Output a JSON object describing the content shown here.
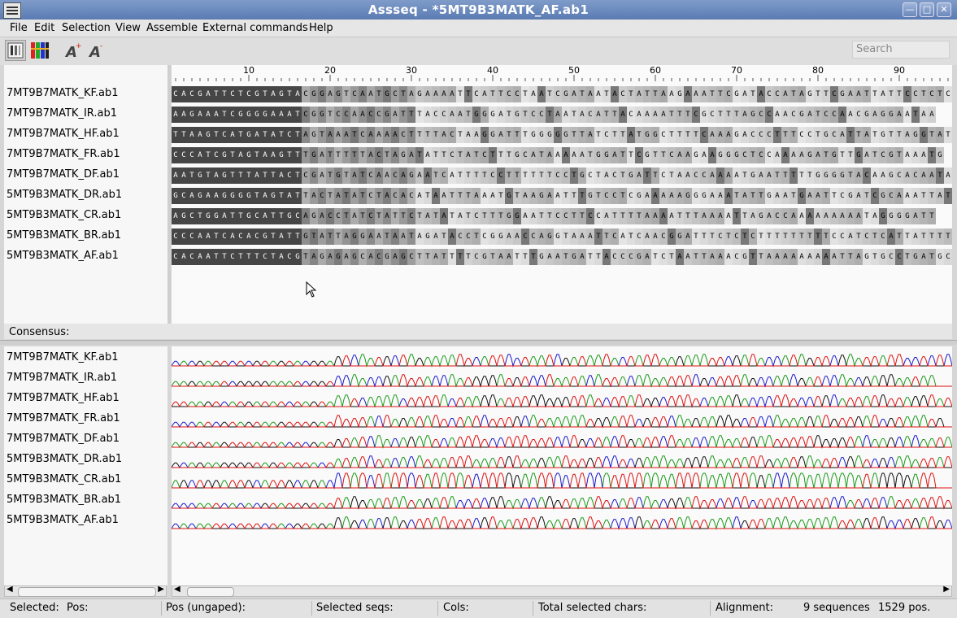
{
  "window": {
    "title": "Assseq - *5MT9B3MATK_AF.ab1"
  },
  "menu": [
    "File",
    "Edit",
    "Selection",
    "View",
    "Assemble",
    "External commands",
    "Help"
  ],
  "toolbar": {
    "buttons": [
      "view-bars-icon",
      "view-color-icon",
      "font-increase-icon",
      "font-decrease-icon"
    ],
    "search_placeholder": "Search"
  },
  "ruler_ticks": [
    "10",
    "20",
    "30",
    "40",
    "50",
    "60",
    "70",
    "80",
    "90"
  ],
  "sequences": [
    {
      "name": "7MT9B7MATK_KF.ab1",
      "bases": "CACGATTCTCGTAGTACGGAGTCAATGCTAGAAAATTCATTCCTAATCGATAATACTATTAAGAAATTCGATACCATAGTTCGAATTATTCCTCTC"
    },
    {
      "name": "7MT9B7MATK_IR.ab1",
      "bases": "AAGAAATCGGGGAAATCGGTCCAACCGATTTACCAATGGGATGTCCTAATACATTACAAAATTTCGCTTTAGCCAACGATCCAACGAGGAATAA"
    },
    {
      "name": "7MT9B7MATK_HF.ab1",
      "bases": "TTAAGTCATGATATCTAGTAAATCAAAACTTTTACTAAGGATTTGGGGGTTATCTTATGGCTTTTCAAAGACCCTTTCCTGCATTATGTTAGGTAT"
    },
    {
      "name": "7MT9B7MATK_FR.ab1",
      "bases": "CCCATCGTAGTAAGTTTGATTTTTACTAGATATTCTATCTTTGCATAAAAATGGATTCGTTCAAGAAGGGCTCCAAAAGATGTTGATCGTAAATG"
    },
    {
      "name": "7MT9B7MATK_DF.ab1",
      "bases": "AATGTAGTTTATTACTCGATGTATCAACAGAATCATTTTCCTTTTTTCCTGCTACTGATTCTAACCAAAATGAATTTTTGGGGTACAAGCACAATA"
    },
    {
      "name": "5MT9B3MATK_DR.ab1",
      "bases": "GCAGAAGGGGTAGTATTACTATATCTACACATAATTTAAATGTAAGAATTTGTCCTCGAAAAAGGGAAATATTGAATGAATTCGATCGCAAATTAT"
    },
    {
      "name": "5MT9B3MATK_CR.ab1",
      "bases": "AGCTGGATTGCATTGCAGACCTATCTATTCTATATATCTTTGGAATTCCTTCCATTTTAAAATTTAAAATTAGACCAAAAAAAAATAGGGGATT"
    },
    {
      "name": "5MT9B3MATK_BR.ab1",
      "bases": "CCCAATCACACGTATTGTATTAGGAATAATAGATACCTCGGAACCAGGTAAATTCATCAACGGATTTCTCTCTTTTTTTTTCCATCTCATTATTTT"
    },
    {
      "name": "5MT9B3MATK_AF.ab1",
      "bases": "CACAATTCTTTCTACGTAGAGAGCACGAGCTTATTTTCGTAATTTGAATGATTACCCGATCTAATTAAACGTTAAAAAAAAATTAGTGCCTGATGC"
    }
  ],
  "consensus_label": "Consensus:",
  "status": {
    "selected": "Selected:",
    "pos": "Pos:",
    "pos_ungaped": "Pos (ungaped):",
    "selected_seqs": "Selected seqs:",
    "cols": "Cols:",
    "total_selected": "Total selected chars:",
    "alignment": "Alignment:",
    "seq_count": "9 sequences",
    "positions": "1529 pos."
  },
  "colors": {
    "trace_a": "#1a9a1a",
    "trace_c": "#1a1acc",
    "trace_g": "#111111",
    "trace_t": "#dd1111"
  }
}
